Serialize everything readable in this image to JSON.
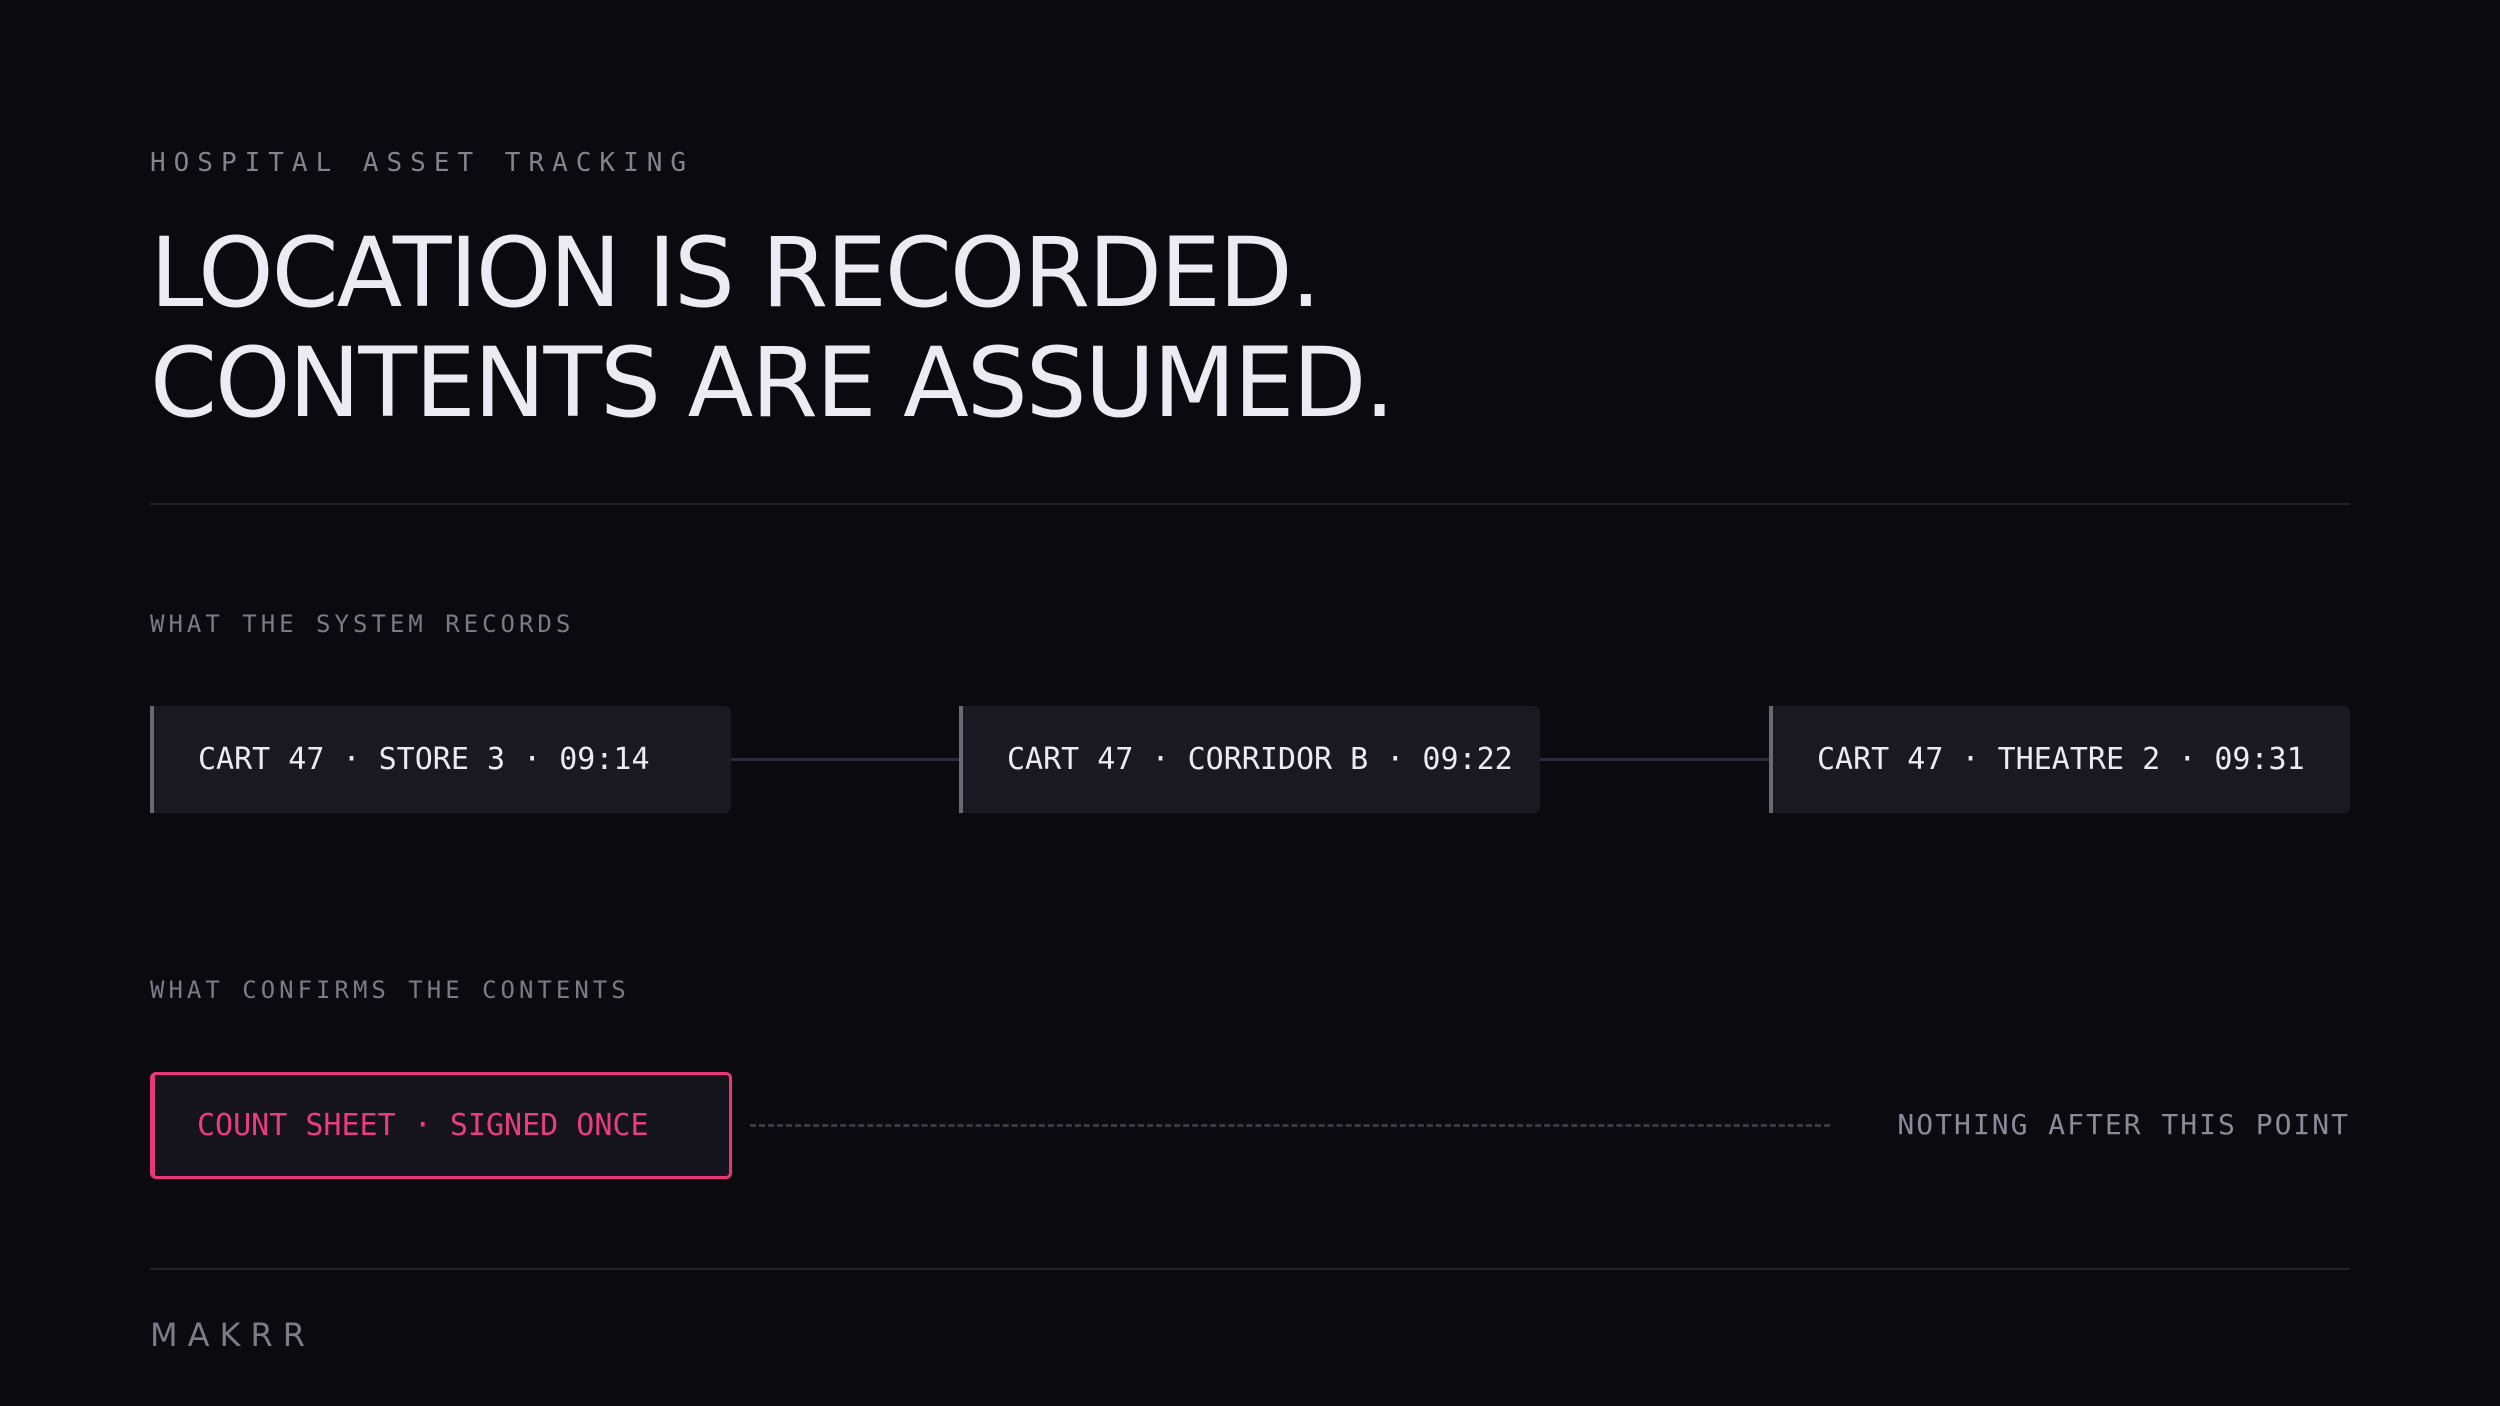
{
  "eyebrow": "HOSPITAL ASSET TRACKING",
  "headline": {
    "line1": "LOCATION IS RECORDED.",
    "line2": "CONTENTS ARE ASSUMED."
  },
  "records": {
    "label": "WHAT THE SYSTEM RECORDS",
    "events": [
      "CART 47 · STORE 3 · 09:14",
      "CART 47 · CORRIDOR B · 09:22",
      "CART 47 · THEATRE 2 · 09:31"
    ]
  },
  "confirmation": {
    "label": "WHAT CONFIRMS THE CONTENTS",
    "count_sheet": "COUNT SHEET · SIGNED ONCE",
    "nothing_after": "NOTHING AFTER THIS POINT"
  },
  "brand": "MAKRR",
  "colors": {
    "background": "#0b0b0f",
    "accent": "#e8367a",
    "text": "#ecebf3",
    "muted": "#85818f"
  }
}
